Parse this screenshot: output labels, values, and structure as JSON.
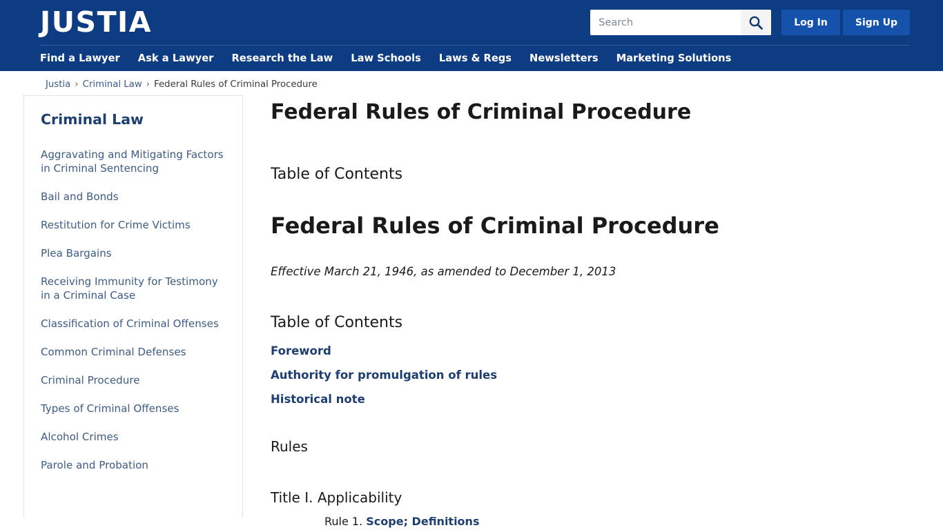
{
  "header": {
    "logo": "JUSTIA",
    "search": {
      "placeholder": "Search",
      "value": "",
      "icon": "search-icon"
    },
    "login_label": "Log In",
    "signup_label": "Sign Up",
    "nav": [
      {
        "label": "Find a Lawyer"
      },
      {
        "label": "Ask a Lawyer"
      },
      {
        "label": "Research the Law"
      },
      {
        "label": "Law Schools"
      },
      {
        "label": "Laws & Regs"
      },
      {
        "label": "Newsletters"
      },
      {
        "label": "Marketing Solutions"
      }
    ],
    "colors": {
      "header_bg": "#0d3c83",
      "button_bg": "#1552ab",
      "link": "#1d3f72"
    }
  },
  "breadcrumb": {
    "items": [
      {
        "label": "Justia",
        "is_link": true
      },
      {
        "label": "Criminal Law",
        "is_link": true
      },
      {
        "label": "Federal Rules of Criminal Procedure",
        "is_link": false
      }
    ],
    "separator": "›"
  },
  "sidebar": {
    "title": "Criminal Law",
    "items": [
      {
        "label": "Aggravating and Mitigating Factors in Criminal Sentencing"
      },
      {
        "label": "Bail and Bonds"
      },
      {
        "label": "Restitution for Crime Victims"
      },
      {
        "label": "Plea Bargains"
      },
      {
        "label": "Receiving Immunity for Testimony in a Criminal Case"
      },
      {
        "label": "Classification of Criminal Offenses"
      },
      {
        "label": "Common Criminal Defenses"
      },
      {
        "label": "Criminal Procedure"
      },
      {
        "label": "Types of Criminal Offenses"
      },
      {
        "label": "Alcohol Crimes"
      },
      {
        "label": "Parole and Probation"
      }
    ]
  },
  "main": {
    "page_title": "Federal Rules of Criminal Procedure",
    "toc_label": "Table of Contents",
    "doc_title": "Federal Rules of Criminal Procedure",
    "effective": "Effective March 21, 1946, as amended to December 1, 2013",
    "toc_heading": "Table of Contents",
    "toc_links": [
      {
        "label": "Foreword"
      },
      {
        "label": "Authority for promulgation of rules"
      },
      {
        "label": "Historical note"
      }
    ],
    "rules_heading": "Rules",
    "title_heading": "Title I. Applicability",
    "rules": [
      {
        "number": "Rule 1.",
        "label": "Scope; Definitions"
      }
    ]
  }
}
